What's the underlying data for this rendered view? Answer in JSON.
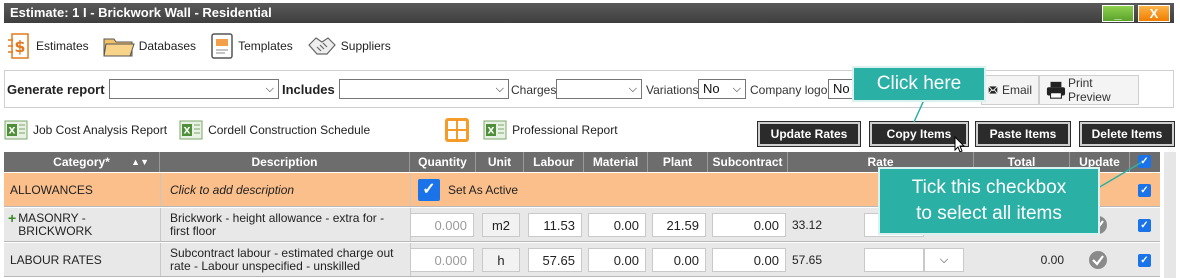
{
  "window": {
    "title": "Estimate: 1 I - Brickwork Wall - Residential",
    "minimize_label": "_",
    "close_label": "X"
  },
  "nav": [
    {
      "label": "Estimates",
      "icon": "dollar-document-icon"
    },
    {
      "label": "Databases",
      "icon": "folder-icon"
    },
    {
      "label": "Templates",
      "icon": "template-icon"
    },
    {
      "label": "Suppliers",
      "icon": "handshake-icon"
    }
  ],
  "filters": {
    "generate_report_label": "Generate report",
    "generate_report_value": "",
    "includes_label": "Includes",
    "includes_value": "",
    "charges_label": "Charges",
    "charges_value": "",
    "variations_label": "Variations",
    "variations_value": "No",
    "company_logo_label": "Company logo",
    "company_logo_value": "No",
    "email_label": "Email",
    "print_preview_label": "Print Preview"
  },
  "reports": [
    {
      "label": "Job Cost Analysis Report",
      "icon": "excel-icon"
    },
    {
      "label": "Cordell Construction Schedule",
      "icon": "excel-icon"
    },
    {
      "label": "",
      "icon": "calculator-icon"
    },
    {
      "label": "Professional Report",
      "icon": "excel-icon"
    }
  ],
  "actions": {
    "update_rates": "Update Rates",
    "copy_items": "Copy Items",
    "paste_items": "Paste Items",
    "delete_items": "Delete Items"
  },
  "table": {
    "headers": {
      "category": "Category*",
      "sort": "▲▼",
      "description": "Description",
      "quantity": "Quantity",
      "unit": "Unit",
      "labour": "Labour",
      "material": "Material",
      "plant": "Plant",
      "subcontract": "Subcontract",
      "rate": "Rate",
      "total": "Total",
      "update": "Update"
    },
    "allowances": {
      "category": "ALLOWANCES",
      "description": "Click to add description",
      "set_active_label": "Set As Active"
    },
    "rows": [
      {
        "category": "MASONRY - BRICKWORK",
        "description": "Brickwork - height allowance - extra for - first floor",
        "quantity": "0.000",
        "unit": "m2",
        "labour": "11.53",
        "material": "0.00",
        "plant": "21.59",
        "subcontract": "0.00",
        "rate": "33.12",
        "total": "",
        "expand": "+"
      },
      {
        "category": "LABOUR RATES",
        "description": "Subcontract labour - estimated charge out rate - Labour unspecified - unskilled",
        "quantity": "0.000",
        "unit": "h",
        "labour": "57.65",
        "material": "0.00",
        "plant": "0.00",
        "subcontract": "0.00",
        "rate": "57.65",
        "total": "0.00"
      }
    ]
  },
  "callouts": {
    "click_here": "Click here",
    "tick_line1": "Tick this checkbox",
    "tick_line2": "to select all items"
  },
  "colors": {
    "titlebar": "#4a4a4a",
    "allowance_row": "#fbbf8b",
    "header": "#6d6d6d",
    "callout": "#2bb0a5",
    "checkbox": "#1a73e8"
  }
}
